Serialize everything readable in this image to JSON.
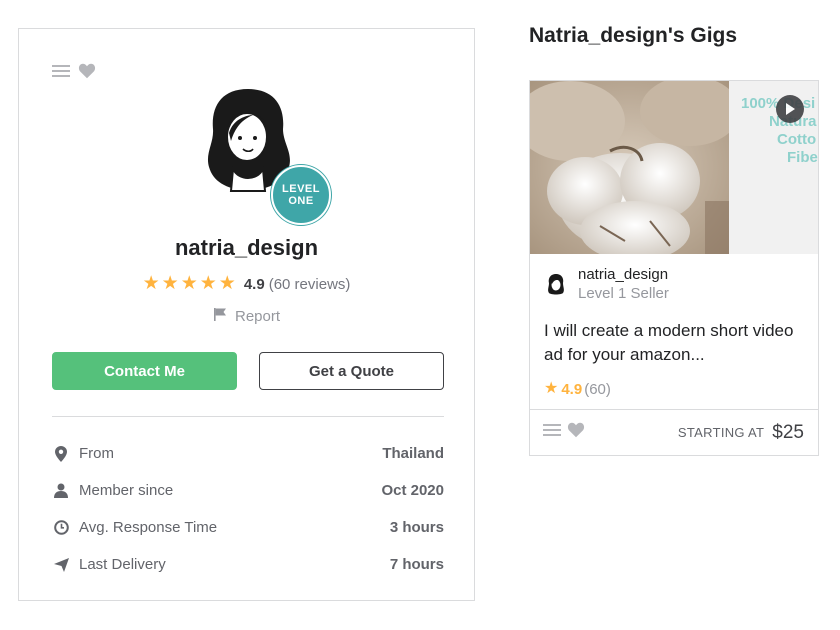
{
  "profile": {
    "username": "natria_design",
    "level_badge": {
      "line1": "LEVEL",
      "line2": "ONE"
    },
    "rating": {
      "score": "4.9",
      "count": "(60 reviews)",
      "stars": 5
    },
    "report_label": "Report",
    "buttons": {
      "contact": "Contact Me",
      "quote": "Get a Quote"
    },
    "stats": [
      {
        "icon": "location-pin-icon",
        "label": "From",
        "value": "Thailand"
      },
      {
        "icon": "user-icon",
        "label": "Member since",
        "value": "Oct 2020"
      },
      {
        "icon": "clock-icon",
        "label": "Avg. Response Time",
        "value": "3 hours"
      },
      {
        "icon": "paper-plane-icon",
        "label": "Last Delivery",
        "value": "7 hours"
      }
    ]
  },
  "gigs_section": {
    "title": "Natria_design's Gigs",
    "gigs": [
      {
        "banner_text": [
          "100% Desi",
          "Natura",
          "Cotto",
          "Fibe"
        ],
        "seller_name": "natria_design",
        "seller_level": "Level 1 Seller",
        "description": "I will create a modern short video ad for your amazon...",
        "rating": "4.9",
        "rating_count": "(60)",
        "starting_label": "STARTING AT",
        "price": "$25"
      }
    ]
  },
  "colors": {
    "green": "#55c17b",
    "star": "#ffb33e",
    "badge": "#3fa6a8",
    "border": "#dadbdd",
    "text": "#404145"
  }
}
